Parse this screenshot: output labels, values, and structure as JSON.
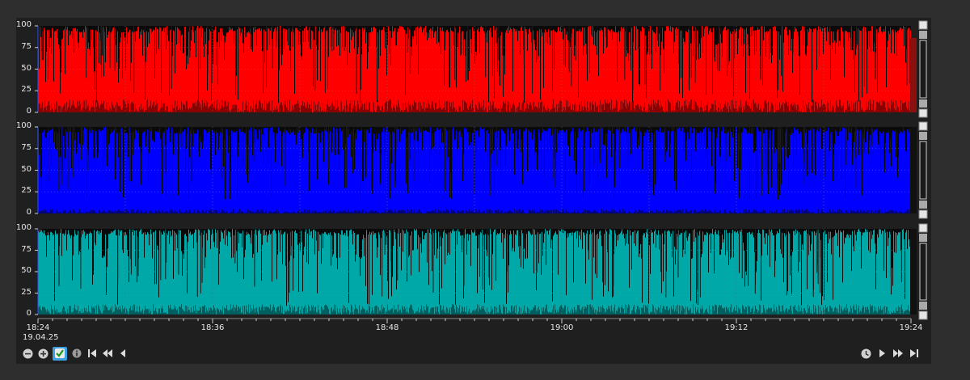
{
  "chart_data": [
    {
      "type": "area",
      "color": "#ff0000",
      "shadow_color": "#8b0000",
      "ylim": [
        0,
        100
      ],
      "yticks": [
        "100",
        "75",
        "50",
        "25",
        "0"
      ],
      "sample_profile": {
        "typical_min": 10,
        "typical_max": 100,
        "floor_max": 15
      }
    },
    {
      "type": "area",
      "color": "#0000ff",
      "shadow_color": "#000080",
      "ylim": [
        0,
        100
      ],
      "yticks": [
        "100",
        "75",
        "50",
        "25",
        "0"
      ],
      "sample_profile": {
        "typical_min": 15,
        "typical_max": 100,
        "floor_max": 5
      }
    },
    {
      "type": "area",
      "color": "#00a8a8",
      "shadow_color": "#006060",
      "ylim": [
        0,
        100
      ],
      "yticks": [
        "100",
        "75",
        "50",
        "25",
        "0"
      ],
      "sample_profile": {
        "typical_min": 10,
        "typical_max": 100,
        "floor_max": 12
      }
    }
  ],
  "x_axis": {
    "range": [
      "18:24",
      "19:24"
    ],
    "tick_labels": [
      "18:24",
      "18:36",
      "18:48",
      "19:00",
      "19:12",
      "19:24"
    ],
    "date": "19.04.25"
  },
  "colors": {
    "background": "#2e2e2e",
    "panel": "#1f1f1f",
    "plot": "#0a0a0a",
    "grid": "#6a6a6a",
    "text": "#e8e8e8"
  },
  "toolbar_left": [
    {
      "icon": "zoom-out-icon"
    },
    {
      "icon": "zoom-in-icon"
    },
    {
      "icon": "check-icon"
    },
    {
      "icon": "info-icon"
    },
    {
      "icon": "skip-to-start-icon"
    },
    {
      "icon": "rewind-icon"
    },
    {
      "icon": "step-back-icon"
    }
  ],
  "toolbar_right": [
    {
      "icon": "clock-icon"
    },
    {
      "icon": "play-icon"
    },
    {
      "icon": "fast-forward-icon"
    },
    {
      "icon": "skip-to-end-icon"
    }
  ]
}
